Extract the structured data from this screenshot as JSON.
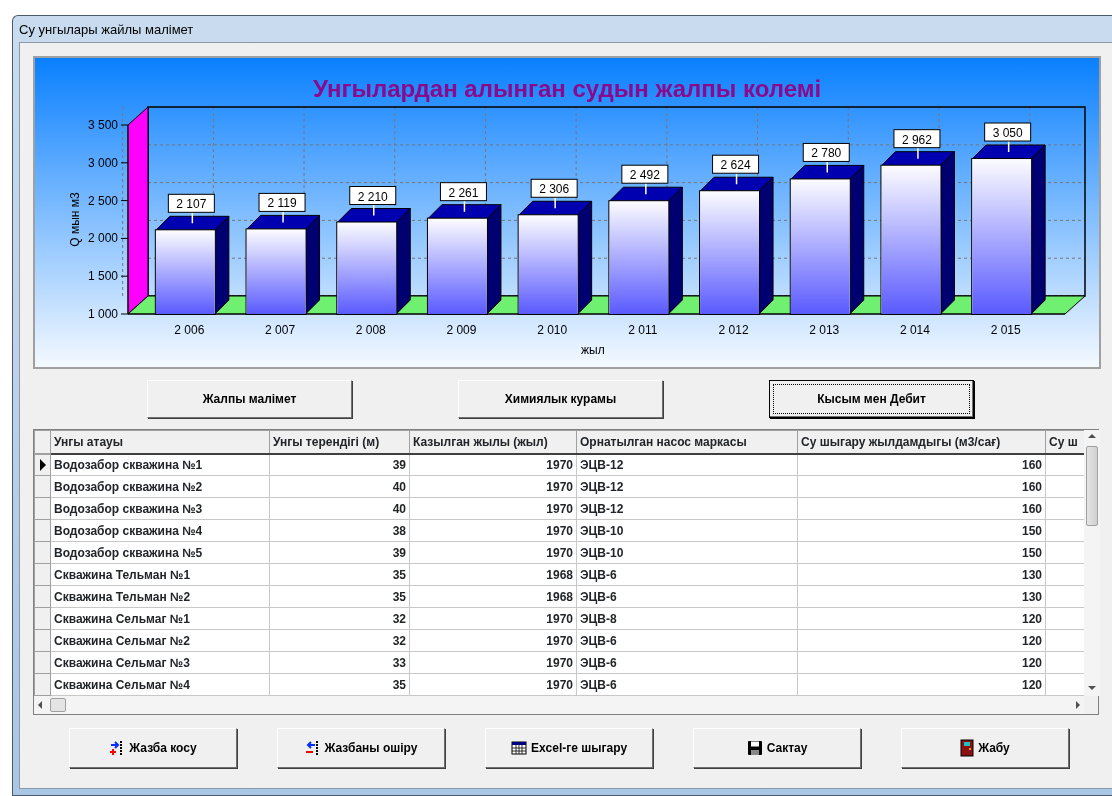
{
  "window": {
    "title": "Су унгылары жайлы малімет"
  },
  "chart": {
    "chart_data": {
      "type": "bar",
      "title": "Унгылардан алынган судын жалпы колемі",
      "xlabel": "жыл",
      "ylabel": "Q мын м3",
      "categories": [
        "2 006",
        "2 007",
        "2 008",
        "2 009",
        "2 010",
        "2 011",
        "2 012",
        "2 013",
        "2 014",
        "2 015"
      ],
      "series": [
        {
          "color": "#5a5aff",
          "values": [
            2107,
            2119,
            2210,
            2261,
            2306,
            2492,
            2624,
            2780,
            2962,
            3050
          ]
        }
      ],
      "ylim": [
        1000,
        3500
      ],
      "yticks": [
        {
          "value": 1000,
          "label": "1 000"
        },
        {
          "value": 1500,
          "label": "1 500"
        },
        {
          "value": 2000,
          "label": "2 000"
        },
        {
          "value": 2500,
          "label": "2 500"
        },
        {
          "value": 3000,
          "label": "3 000"
        },
        {
          "value": 3500,
          "label": "3 500"
        }
      ],
      "data_labels": true
    }
  },
  "view_buttons": [
    {
      "label": "Жалпы малімет",
      "selected": false
    },
    {
      "label": "Химиялык курамы",
      "selected": false
    },
    {
      "label": "Кысым мен Дебит",
      "selected": true
    }
  ],
  "table": {
    "columns": [
      "Унгы атауы",
      "Унгы терендігі (м)",
      "Казылган жылы (жыл)",
      "Орнатылган насос маркасы",
      "Су шыгару жылдамдыгы (м3/сағ)",
      "Су ш"
    ],
    "rows": [
      {
        "selected": true,
        "cells": [
          "Водозабор скважина №1",
          "39",
          "1970",
          "ЭЦВ-12",
          "160"
        ]
      },
      {
        "selected": false,
        "cells": [
          "Водозабор скважина №2",
          "40",
          "1970",
          "ЭЦВ-12",
          "160"
        ]
      },
      {
        "selected": false,
        "cells": [
          "Водозабор скважина №3",
          "40",
          "1970",
          "ЭЦВ-12",
          "160"
        ]
      },
      {
        "selected": false,
        "cells": [
          "Водозабор скважина №4",
          "38",
          "1970",
          "ЭЦВ-10",
          "150"
        ]
      },
      {
        "selected": false,
        "cells": [
          "Водозабор скважина №5",
          "39",
          "1970",
          "ЭЦВ-10",
          "150"
        ]
      },
      {
        "selected": false,
        "cells": [
          "Скважина Тельман №1",
          "35",
          "1968",
          "ЭЦВ-6",
          "130"
        ]
      },
      {
        "selected": false,
        "cells": [
          "Скважина Тельман №2",
          "35",
          "1968",
          "ЭЦВ-6",
          "130"
        ]
      },
      {
        "selected": false,
        "cells": [
          "Скважина Сельмаг №1",
          "32",
          "1970",
          "ЭЦВ-8",
          "120"
        ]
      },
      {
        "selected": false,
        "cells": [
          "Скважина Сельмаг №2",
          "32",
          "1970",
          "ЭЦВ-6",
          "120"
        ]
      },
      {
        "selected": false,
        "cells": [
          "Скважина Сельмаг №3",
          "33",
          "1970",
          "ЭЦВ-6",
          "120"
        ]
      },
      {
        "selected": false,
        "cells": [
          "Скважина Сельмаг №4",
          "35",
          "1970",
          "ЭЦВ-6",
          "120"
        ]
      }
    ]
  },
  "action_buttons": [
    {
      "kind": "add",
      "label": "Жазба косу"
    },
    {
      "kind": "delete",
      "label": "Жазбаны ошіру"
    },
    {
      "kind": "excel",
      "label": "Excel-ге шыгару"
    },
    {
      "kind": "save",
      "label": "Сактау"
    },
    {
      "kind": "exit",
      "label": "Жабу"
    }
  ]
}
